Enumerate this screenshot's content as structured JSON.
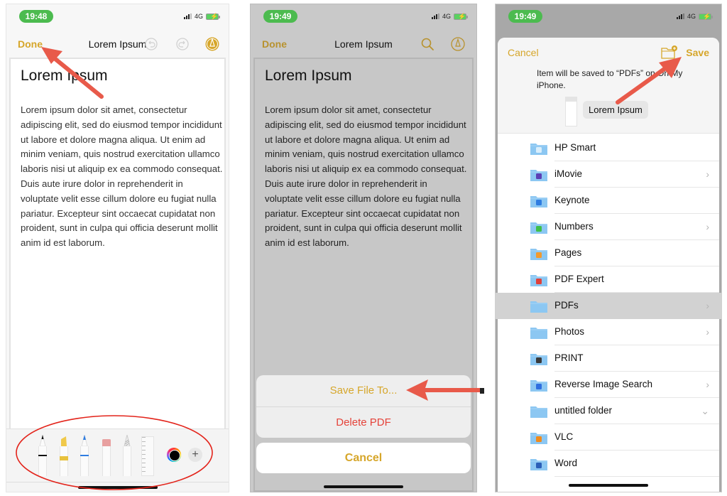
{
  "colors": {
    "accent": "#d6a62a",
    "destructive": "#e5433a",
    "annotation": "#e85a4a",
    "status_green": "#4cbb4f",
    "folder_blue": "#8cc7f2"
  },
  "screen1": {
    "status": {
      "time": "19:48",
      "network": "4G"
    },
    "nav": {
      "left": "Done",
      "title": "Lorem Ipsum",
      "icons": [
        "undo-icon",
        "redo-icon",
        "markup-pen-icon"
      ]
    },
    "doc": {
      "heading": "Lorem Ipsum",
      "body": "Lorem ipsum dolor sit amet, consectetur adipiscing elit, sed do eiusmod tempor incididunt ut labore et dolore magna aliqua. Ut enim ad minim veniam, quis nostrud exercitation ullamco laboris nisi ut aliquip ex ea commodo consequat. Duis aute irure dolor in reprehenderit in voluptate velit esse cillum dolore eu fugiat nulla pariatur. Excepteur sint occaecat cupidatat non proident, sunt in culpa qui officia deserunt mollit anim id est laborum."
    },
    "toolbar": {
      "tools": [
        "pen",
        "highlighter",
        "pencil-blue",
        "eraser",
        "lasso",
        "ruler"
      ],
      "color_well": "color-picker",
      "plus": "+"
    }
  },
  "screen2": {
    "status": {
      "time": "19:49",
      "network": "4G"
    },
    "nav": {
      "left": "Done",
      "title": "Lorem Ipsum",
      "icons": [
        "search-icon",
        "markup-pen-icon"
      ]
    },
    "doc": {
      "heading": "Lorem Ipsum",
      "body": "Lorem ipsum dolor sit amet, consectetur adipiscing elit, sed do eiusmod tempor incididunt ut labore et dolore magna aliqua. Ut enim ad minim veniam, quis nostrud exercitation ullamco laboris nisi ut aliquip ex ea commodo consequat. Duis aute irure dolor in reprehenderit in voluptate velit esse cillum dolore eu fugiat nulla pariatur. Excepteur sint occaecat cupidatat non proident, sunt in culpa qui officia deserunt mollit anim id est laborum."
    },
    "action_sheet": {
      "save": "Save File To...",
      "delete": "Delete PDF",
      "cancel": "Cancel"
    }
  },
  "screen3": {
    "status": {
      "time": "19:49",
      "network": "4G"
    },
    "header": {
      "cancel": "Cancel",
      "save": "Save",
      "message": "Item will be saved to “PDFs” on On My iPhone.",
      "filename": "Lorem Ipsum"
    },
    "folders": [
      {
        "name": "HP Smart",
        "badge": "#d9eefc",
        "chevron": ""
      },
      {
        "name": "iMovie",
        "badge": "#5b3fb5",
        "chevron": "›"
      },
      {
        "name": "Keynote",
        "badge": "#2f7de1",
        "chevron": ""
      },
      {
        "name": "Numbers",
        "badge": "#3fbf4a",
        "chevron": "›"
      },
      {
        "name": "Pages",
        "badge": "#f29a2e",
        "chevron": ""
      },
      {
        "name": "PDF Expert",
        "badge": "#e0403a",
        "chevron": ""
      },
      {
        "name": "PDFs",
        "badge": "",
        "chevron": "›",
        "selected": true
      },
      {
        "name": "Photos",
        "badge": "",
        "chevron": "›"
      },
      {
        "name": "PRINT",
        "badge": "#3a3a3a",
        "chevron": ""
      },
      {
        "name": "Reverse Image Search",
        "badge": "#2f6fe0",
        "chevron": "›"
      },
      {
        "name": "untitled folder",
        "badge": "",
        "chevron": "⌄"
      },
      {
        "name": "VLC",
        "badge": "#f08a1c",
        "chevron": ""
      },
      {
        "name": "Word",
        "badge": "#2b5fb8",
        "chevron": ""
      }
    ]
  }
}
